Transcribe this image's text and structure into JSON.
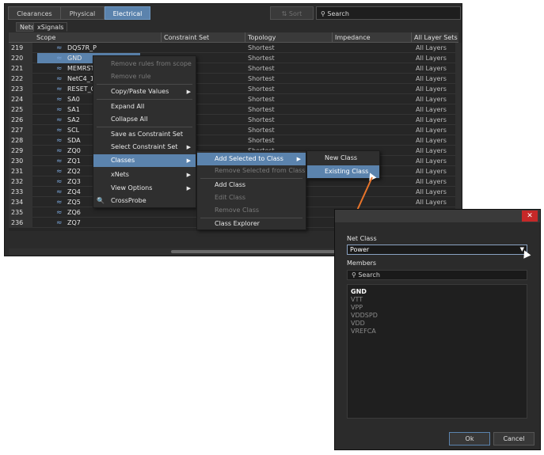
{
  "toolbar": {
    "tabs": [
      {
        "label": "Clearances"
      },
      {
        "label": "Physical"
      },
      {
        "label": "Electrical"
      }
    ],
    "sort_label": "Sort",
    "search_placeholder": "Search"
  },
  "subtabs": [
    {
      "label": "Nets"
    },
    {
      "label": "xSignals"
    }
  ],
  "columns": [
    "Scope",
    "Constraint Set",
    "Topology",
    "Impedance",
    "All Layer Sets"
  ],
  "rows": [
    {
      "num": "219",
      "name": "DQS7R_P",
      "topology": "Shortest",
      "layers": "All Layers"
    },
    {
      "num": "220",
      "name": "GND",
      "topology": "Shortest",
      "layers": "All Layers"
    },
    {
      "num": "221",
      "name": "MEMRST",
      "topology": "Shortest",
      "layers": "All Layers"
    },
    {
      "num": "222",
      "name": "NetC4_1",
      "topology": "Shortest",
      "layers": "All Layers"
    },
    {
      "num": "223",
      "name": "RESET_COI",
      "topology": "Shortest",
      "layers": "All Layers"
    },
    {
      "num": "224",
      "name": "SA0",
      "topology": "Shortest",
      "layers": "All Layers"
    },
    {
      "num": "225",
      "name": "SA1",
      "topology": "Shortest",
      "layers": "All Layers"
    },
    {
      "num": "226",
      "name": "SA2",
      "topology": "Shortest",
      "layers": "All Layers"
    },
    {
      "num": "227",
      "name": "SCL",
      "topology": "Shortest",
      "layers": "All Layers"
    },
    {
      "num": "228",
      "name": "SDA",
      "topology": "Shortest",
      "layers": "All Layers"
    },
    {
      "num": "229",
      "name": "ZQ0",
      "topology": "Shortest",
      "layers": "All Layers"
    },
    {
      "num": "230",
      "name": "ZQ1",
      "topology": "",
      "layers": "All Layers"
    },
    {
      "num": "231",
      "name": "ZQ2",
      "topology": "",
      "layers": "All Layers"
    },
    {
      "num": "232",
      "name": "ZQ3",
      "topology": "",
      "layers": "All Layers"
    },
    {
      "num": "233",
      "name": "ZQ4",
      "topology": "",
      "layers": "All Layers"
    },
    {
      "num": "234",
      "name": "ZQ5",
      "topology": "",
      "layers": "All Layers"
    },
    {
      "num": "235",
      "name": "ZQ6",
      "topology": "",
      "layers": ""
    },
    {
      "num": "236",
      "name": "ZQ7",
      "topology": "",
      "layers": ""
    }
  ],
  "menu1": {
    "items": [
      "Remove rules from scope",
      "Remove rule",
      "Copy/Paste Values",
      "Expand All",
      "Collapse All",
      "Save as Constraint Set",
      "Select Constraint Set",
      "Classes",
      "xNets",
      "View Options",
      "CrossProbe"
    ]
  },
  "menu2": {
    "items": [
      "Add Selected to Class",
      "Remove Selected from Class",
      "Add Class",
      "Edit Class",
      "Remove Class",
      "Class Explorer"
    ]
  },
  "menu3": {
    "items": [
      "New Class",
      "Existing Class"
    ]
  },
  "dialog": {
    "close_glyph": "✕",
    "net_class_label": "Net Class",
    "net_class_value": "Power",
    "members_label": "Members",
    "members_search_placeholder": "Search",
    "members": [
      "GND",
      "VTT",
      "VPP",
      "VDDSPD",
      "VDD",
      "VREFCA"
    ],
    "ok_label": "Ok",
    "cancel_label": "Cancel"
  },
  "colors": {
    "accent": "#5b83ad",
    "arrow": "#e8742a",
    "close": "#c62828"
  }
}
